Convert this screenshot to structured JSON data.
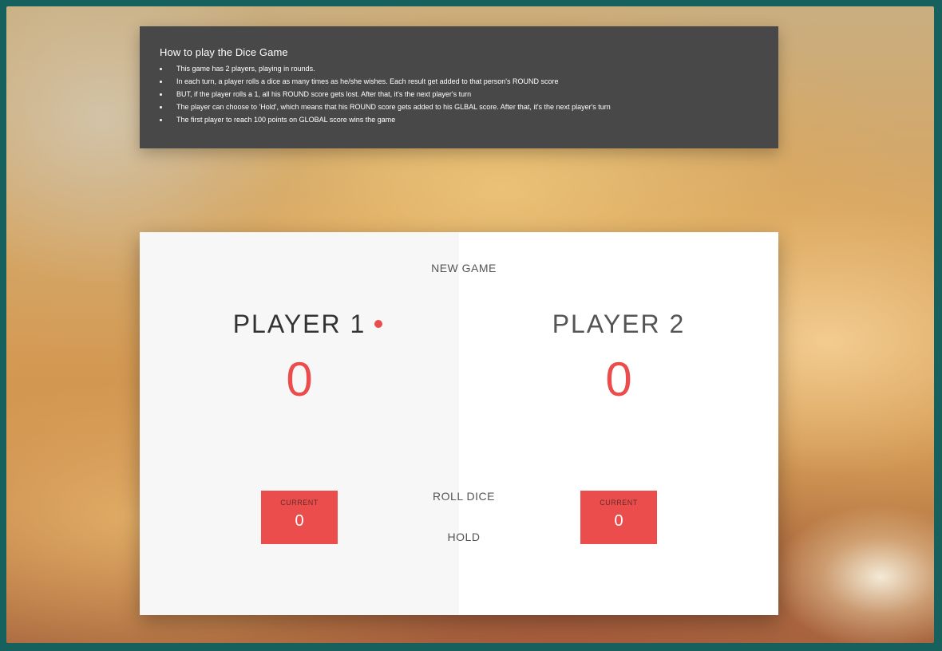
{
  "rules": {
    "title": "How to play the Dice Game",
    "items": [
      "This game has 2 players, playing in rounds.",
      "In each turn, a player rolls a dice as many times as he/she wishes. Each result get added to that person's ROUND score",
      "BUT, if the player rolls a 1, all his ROUND score gets lost. After that, it's the next player's turn",
      "The player can choose to 'Hold', which means that his ROUND score gets added to his GLBAL score. After that, it's the next player's turn",
      "The first player to reach 100 points on GLOBAL score wins the game"
    ]
  },
  "game": {
    "new_game_label": "NEW GAME",
    "roll_dice_label": "ROLL DICE",
    "hold_label": "HOLD",
    "active_player": 1,
    "accent_color": "#eb4d4d",
    "players": [
      {
        "name": "PLAYER 1",
        "score": "0",
        "current_label": "CURRENT",
        "current_score": "0"
      },
      {
        "name": "PLAYER 2",
        "score": "0",
        "current_label": "CURRENT",
        "current_score": "0"
      }
    ]
  }
}
